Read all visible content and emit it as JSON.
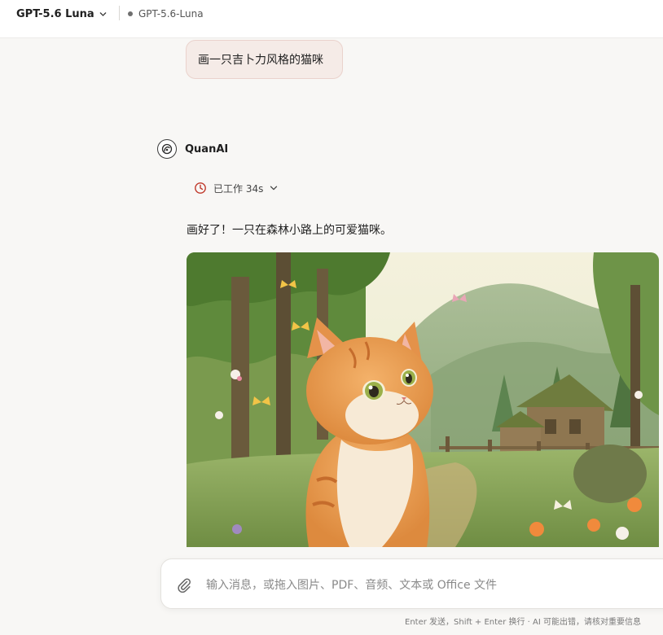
{
  "header": {
    "model_name": "GPT-5.6 Luna",
    "active_model_tag": "GPT-5.6-Luna"
  },
  "conversation": {
    "user_message": "画一只吉卜力风格的猫咪",
    "assistant": {
      "name": "QuanAI",
      "work_status": "已工作 34s",
      "answer": "画好了！一只在森林小路上的可爱猫咪。",
      "image_subject": "ghibli-style-cat-in-forest"
    }
  },
  "composer": {
    "placeholder": "输入消息，或拖入图片、PDF、音频、文本或 Office 文件",
    "value": ""
  },
  "footer": {
    "hint": "Enter 发送，Shift + Enter 换行 · AI 可能出错，请核对重要信息"
  },
  "colors": {
    "background": "#f8f7f5",
    "user_bubble": "#f5ebe7",
    "status_clock": "#c0392b"
  },
  "icons": {
    "model_chevron": "chevron-down-icon",
    "work_clock": "clock-icon",
    "work_chevron": "chevron-down-icon",
    "attach": "paperclip-icon"
  }
}
